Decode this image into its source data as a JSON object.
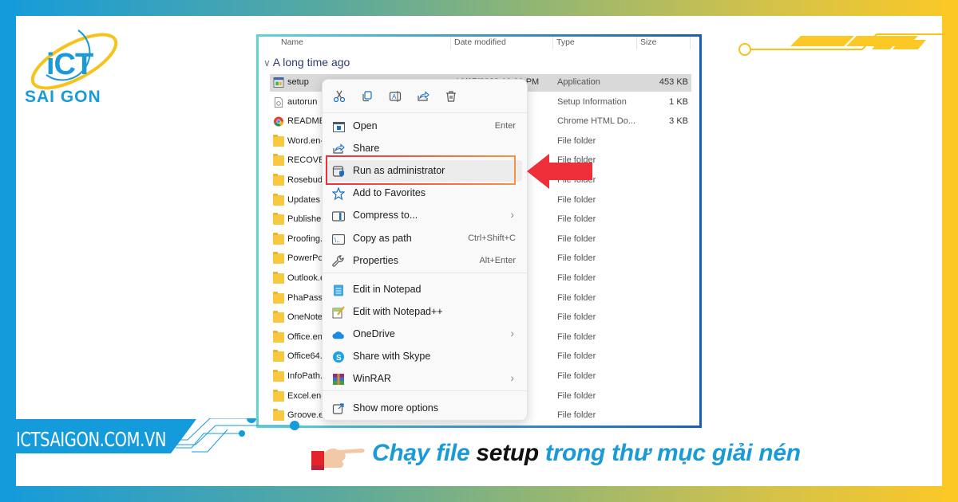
{
  "brand": {
    "logo_main": "iCT",
    "logo_sub": "SAI GON",
    "website": "ICTSAIGON.COM.VN",
    "colors": {
      "blue": "#149bdc",
      "yellow": "#fcc826",
      "red_accent": "#ee2f3a"
    }
  },
  "explorer": {
    "columns": [
      "Name",
      "Date modified",
      "Type",
      "Size"
    ],
    "group_label": "A long time ago",
    "rows": [
      {
        "name": "setup",
        "icon": "application-icon",
        "date": "10/27/2023 10:00 PM",
        "type": "Application",
        "size": "453 KB",
        "selected": true
      },
      {
        "name": "autorun",
        "icon": "setup-info-icon",
        "date": "",
        "type": "Setup Information",
        "size": "1 KB"
      },
      {
        "name": "README",
        "icon": "chrome-icon",
        "date": "",
        "type": "Chrome HTML Do...",
        "size": "3 KB"
      },
      {
        "name": "Word.en-",
        "icon": "folder-icon",
        "type": "File folder",
        "size": ""
      },
      {
        "name": "RECOVER",
        "icon": "folder-icon",
        "type": "File folder",
        "size": ""
      },
      {
        "name": "Rosebud.",
        "icon": "folder-icon",
        "type": "File folder",
        "size": ""
      },
      {
        "name": "Updates",
        "icon": "folder-icon",
        "type": "File folder",
        "size": ""
      },
      {
        "name": "Publisher.",
        "icon": "folder-icon",
        "type": "File folder",
        "size": ""
      },
      {
        "name": "Proofing.",
        "icon": "folder-icon",
        "type": "File folder",
        "size": ""
      },
      {
        "name": "PowerPoi",
        "icon": "folder-icon",
        "type": "File folder",
        "size": ""
      },
      {
        "name": "Outlook.e",
        "icon": "folder-icon",
        "type": "File folder",
        "size": ""
      },
      {
        "name": "PhaPassO",
        "icon": "folder-icon",
        "type": "File folder",
        "size": ""
      },
      {
        "name": "OneNote.",
        "icon": "folder-icon",
        "type": "File folder",
        "size": ""
      },
      {
        "name": "Office.en-",
        "icon": "folder-icon",
        "type": "File folder",
        "size": ""
      },
      {
        "name": "Office64.e",
        "icon": "folder-icon",
        "type": "File folder",
        "size": ""
      },
      {
        "name": "InfoPath.",
        "icon": "folder-icon",
        "type": "File folder",
        "size": ""
      },
      {
        "name": "Excel.en-",
        "icon": "folder-icon",
        "type": "File folder",
        "size": ""
      },
      {
        "name": "Groove.er",
        "icon": "folder-icon",
        "type": "File folder",
        "size": ""
      }
    ]
  },
  "context_menu": {
    "toolbar": [
      "cut-icon",
      "copy-icon",
      "rename-icon",
      "share-icon",
      "delete-icon"
    ],
    "items": [
      {
        "label": "Open",
        "shortcut": "Enter",
        "icon": "open-icon"
      },
      {
        "label": "Share",
        "shortcut": "",
        "icon": "share-icon"
      },
      {
        "label": "Run as administrator",
        "shortcut": "",
        "icon": "shield-icon",
        "highlighted": true
      },
      {
        "label": "Add to Favorites",
        "shortcut": "",
        "icon": "star-icon"
      },
      {
        "label": "Compress to...",
        "shortcut": "",
        "icon": "zip-icon",
        "submenu": true
      },
      {
        "label": "Copy as path",
        "shortcut": "Ctrl+Shift+C",
        "icon": "path-icon"
      },
      {
        "label": "Properties",
        "shortcut": "Alt+Enter",
        "icon": "wrench-icon"
      },
      {
        "label": "Edit in Notepad",
        "shortcut": "",
        "icon": "notepad-icon"
      },
      {
        "label": "Edit with Notepad++",
        "shortcut": "",
        "icon": "notepadpp-icon"
      },
      {
        "label": "OneDrive",
        "shortcut": "",
        "icon": "onedrive-icon",
        "submenu": true
      },
      {
        "label": "Share with Skype",
        "shortcut": "",
        "icon": "skype-icon"
      },
      {
        "label": "WinRAR",
        "shortcut": "",
        "icon": "winrar-icon",
        "submenu": true
      },
      {
        "label": "Show more options",
        "shortcut": "",
        "icon": "more-options-icon"
      }
    ]
  },
  "caption": {
    "part1": "Chạy file ",
    "emphasis": "setup",
    "part2": " trong thư mục giải nén"
  }
}
